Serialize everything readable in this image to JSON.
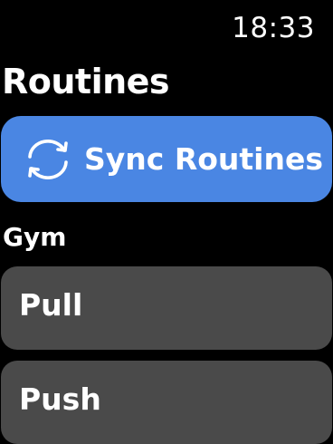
{
  "status_bar": {
    "time": "18:33"
  },
  "page": {
    "title": "Routines"
  },
  "sync_button": {
    "label": "Sync Routines",
    "icon": "sync-arrows-icon",
    "color": "#4a86e3"
  },
  "section": {
    "header": "Gym"
  },
  "routines": [
    {
      "label": "Pull"
    },
    {
      "label": "Push"
    }
  ],
  "colors": {
    "background": "#000000",
    "list_item": "#4a4a4a",
    "text": "#ffffff"
  }
}
